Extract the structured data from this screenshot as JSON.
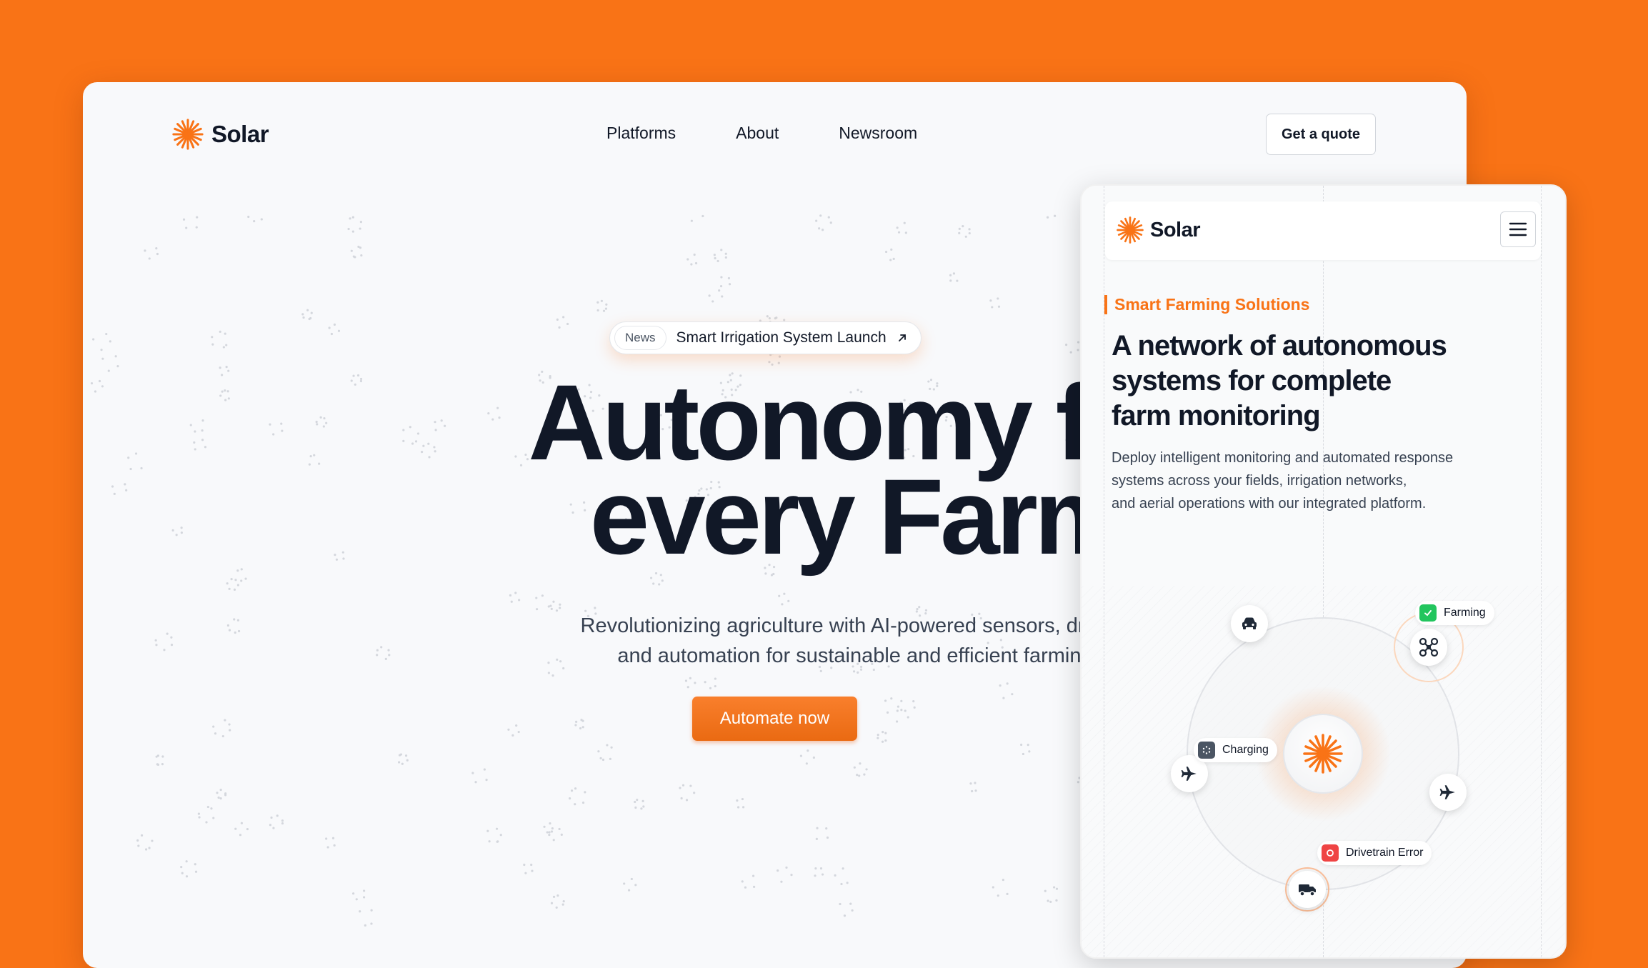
{
  "brand": {
    "name": "Solar",
    "accent": "#F97316",
    "background": "#F97316"
  },
  "nav": {
    "items": [
      "Platforms",
      "About",
      "Newsroom"
    ],
    "cta": "Get a quote"
  },
  "hero": {
    "news_tag": "News",
    "news_text": "Smart Irrigation System Launch",
    "news_icon": "arrow-up-right-icon",
    "title_line1": "Autonomy for",
    "title_line2": "every Farm",
    "subtitle_line1": "Revolutionizing agriculture with AI-powered sensors, drones,",
    "subtitle_line2": "and automation for sustainable and efficient farming.",
    "cta": "Automate now"
  },
  "mobile": {
    "brand": "Solar",
    "menu_icon": "hamburger-menu-icon",
    "eyebrow": "Smart Farming Solutions",
    "title_line1": "A network of autonomous",
    "title_line2": "systems for complete",
    "title_line3": "farm monitoring",
    "desc_line1": "Deploy intelligent monitoring and automated response",
    "desc_line2": "systems across your fields, irrigation networks,",
    "desc_line3": "and aerial operations with our integrated platform.",
    "badges": {
      "farming": "Farming",
      "charging": "Charging",
      "error": "Drivetrain Error"
    },
    "status_colors": {
      "farming": "#22C55E",
      "charging": "#4B5563",
      "error": "#EF4444"
    }
  }
}
